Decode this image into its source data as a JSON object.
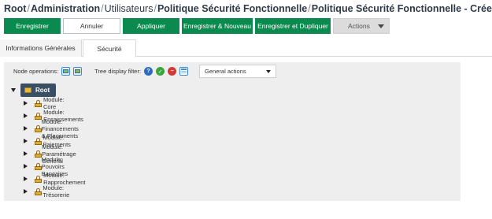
{
  "breadcrumb": [
    {
      "label": "Root",
      "bold": true
    },
    {
      "label": "Administration",
      "bold": true
    },
    {
      "label": "Utilisateurs",
      "bold": false
    },
    {
      "label": "Politique Sécurité Fonctionnelle",
      "bold": true
    },
    {
      "label": "Politique Sécurité Fonctionnelle - Créer",
      "bold": true
    }
  ],
  "toolbar": {
    "save": "Enregistrer",
    "cancel": "Annuler",
    "apply": "Appliquer",
    "save_new": "Enregistrer & Nouveau",
    "save_duplicate": "Enregistrer et Dupliquer",
    "actions": "Actions"
  },
  "tabs": {
    "general": "Informations Générales",
    "security": "Sécurité"
  },
  "ops": {
    "node_operations": "Node operations:",
    "tree_filter": "Tree display filter:",
    "general_actions": "General actions"
  },
  "tree": {
    "root": "Root",
    "modules": [
      "Module: Core",
      "Module: Encaissements",
      "Module: Financements & Placements",
      "Module: Paiements",
      "Module: Paramétrage Général",
      "Module: Pouvoirs Bancaires",
      "Module: Rapprochement",
      "Module: Trésorerie"
    ]
  },
  "colors": {
    "primary_green": "#0a8a4e",
    "root_chip": "#3a4f63",
    "panel_bg": "#eeeeee"
  }
}
